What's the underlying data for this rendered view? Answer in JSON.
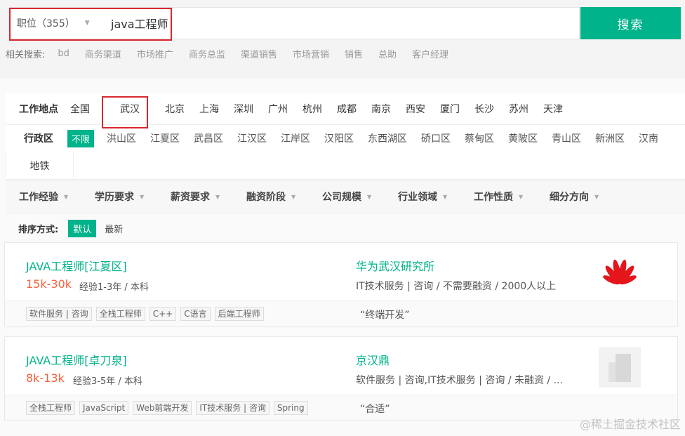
{
  "search": {
    "type_label": "职位（355）",
    "query": "java工程师",
    "button": "搜索"
  },
  "related": {
    "label": "相关搜索:",
    "keywords": [
      "bd",
      "商务渠道",
      "市场推广",
      "商务总监",
      "渠道销售",
      "市场营销",
      "销售",
      "总助",
      "客户经理"
    ]
  },
  "filters": {
    "city_title": "工作地点",
    "cities": [
      "全国",
      "武汉",
      "北京",
      "上海",
      "深圳",
      "广州",
      "杭州",
      "成都",
      "南京",
      "西安",
      "厦门",
      "长沙",
      "苏州",
      "天津"
    ],
    "district_title": "行政区",
    "district_all": "不限",
    "districts": [
      "洪山区",
      "江夏区",
      "武昌区",
      "江汉区",
      "江岸区",
      "汉阳区",
      "东西湖区",
      "硚口区",
      "蔡甸区",
      "黄陂区",
      "青山区",
      "新洲区",
      "汉南"
    ],
    "subway": "地铁",
    "dropdowns": [
      "工作经验",
      "学历要求",
      "薪资要求",
      "融资阶段",
      "公司规模",
      "行业领域",
      "工作性质",
      "细分方向"
    ]
  },
  "sort": {
    "label": "排序方式:",
    "default": "默认",
    "latest": "最新"
  },
  "jobs": [
    {
      "title": "JAVA工程师[江夏区]",
      "salary": "15k-30k",
      "requirements": "经验1-3年 / 本科",
      "company": "华为武汉研究所",
      "industry": "IT技术服务 | 咨询 / 不需要融资 / 2000人以上",
      "tags": [
        "软件服务 | 咨询",
        "全栈工程师",
        "C++",
        "C语言",
        "后端工程师"
      ],
      "slogan": "“终端开发”"
    },
    {
      "title": "JAVA工程师[卓刀泉]",
      "salary": "8k-13k",
      "requirements": "经验3-5年 / 本科",
      "company": "京汉鼎",
      "industry": "软件服务 | 咨询,IT技术服务 | 咨询 / 未融资 / ...",
      "tags": [
        "全栈工程师",
        "JavaScript",
        "Web前端开发",
        "IT技术服务 | 咨询",
        "Spring"
      ],
      "slogan": "“合适”"
    }
  ],
  "watermark": "@稀土掘金技术社区",
  "colors": {
    "accent": "#00b38a",
    "salary": "#fd5f39",
    "highlight": "#d9272e"
  }
}
